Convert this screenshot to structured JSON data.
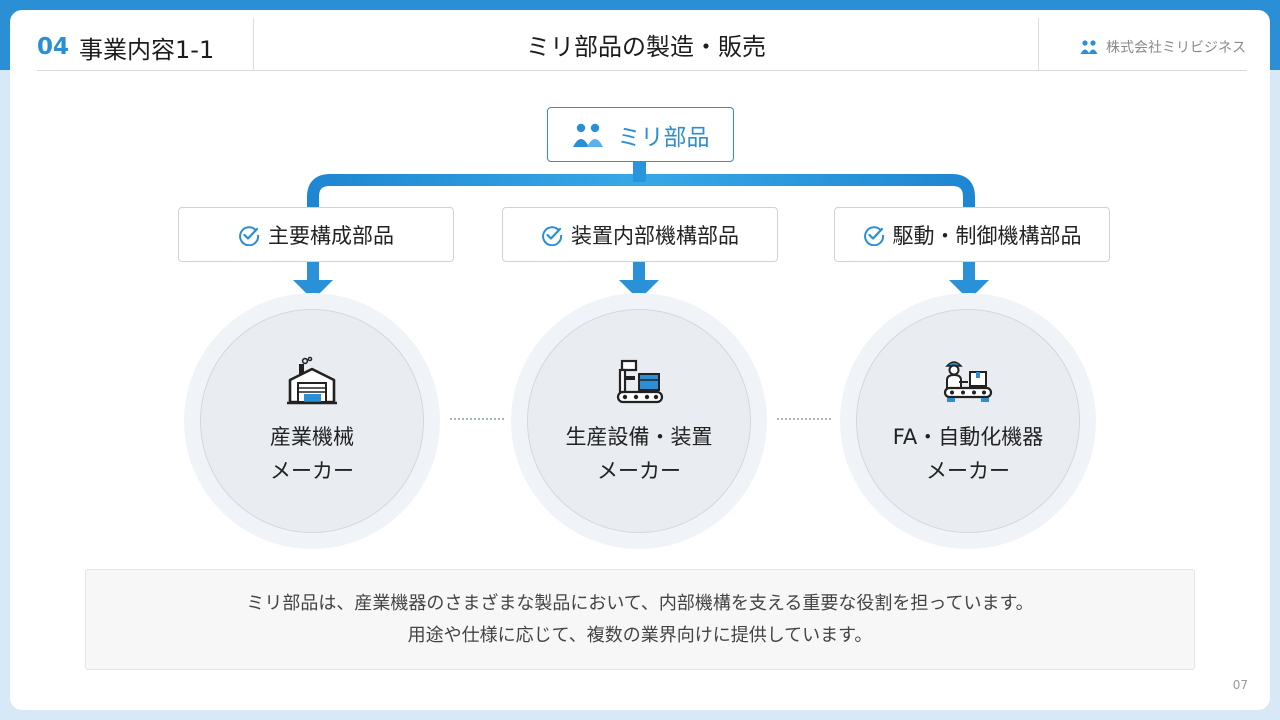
{
  "header": {
    "section_number": "04",
    "section_title": "事業内容1-1",
    "page_title": "ミリ部品の製造・販売",
    "company_name": "株式会社ミリビジネス"
  },
  "root": {
    "label": "ミリ部品"
  },
  "categories": [
    {
      "label": "主要構成部品"
    },
    {
      "label": "装置内部機構部品"
    },
    {
      "label": "駆動・制御機構部品"
    }
  ],
  "targets": [
    {
      "line1": "産業機械",
      "line2": "メーカー",
      "icon": "factory-icon"
    },
    {
      "line1": "生産設備・装置",
      "line2": "メーカー",
      "icon": "production-equipment-icon"
    },
    {
      "line1": "FA・自動化機器",
      "line2": "メーカー",
      "icon": "worker-conveyor-icon"
    }
  ],
  "description": {
    "line1": "ミリ部品は、産業機器のさまざまな製品において、内部機構を支える重要な役割を担っています。",
    "line2": "用途や仕様に応じて、複数の業界向けに提供しています。"
  },
  "page_number": "07",
  "colors": {
    "accent": "#2b8fd6",
    "arrow": "#2a91d8",
    "circle": "#e9edf1"
  }
}
